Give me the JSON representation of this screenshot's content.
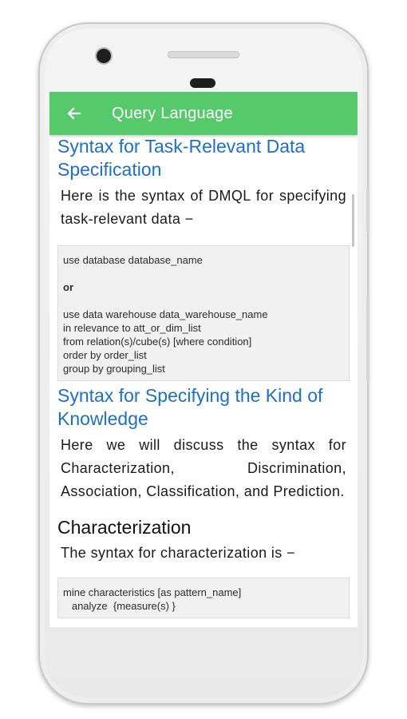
{
  "appbar": {
    "title": "Query Language",
    "back_icon": "arrow-left-icon",
    "color": "#56c96b"
  },
  "sections": {
    "s1": {
      "heading": "Syntax for Task-Relevant Data Specification",
      "para": "Here is the syntax of DMQL for specifying task-relevant data −",
      "code": [
        "use database database_name",
        "",
        "or",
        "",
        "use data warehouse data_warehouse_name",
        "in relevance to att_or_dim_list",
        "from relation(s)/cube(s) [where condition]",
        "order by order_list",
        "group by grouping_list"
      ]
    },
    "s2": {
      "heading": "Syntax for Specifying the Kind of Knowledge",
      "para": "Here we will discuss the syntax for Characterization, Discrimination, Association, Classification, and Prediction."
    },
    "s3": {
      "heading": "Characterization",
      "para": "The syntax for characterization is −",
      "code": [
        "mine characteristics [as pattern_name]",
        "   analyze  {measure(s) }"
      ]
    }
  },
  "colors": {
    "heading": "#1e70c6",
    "code_bg": "#f1f1f1"
  }
}
